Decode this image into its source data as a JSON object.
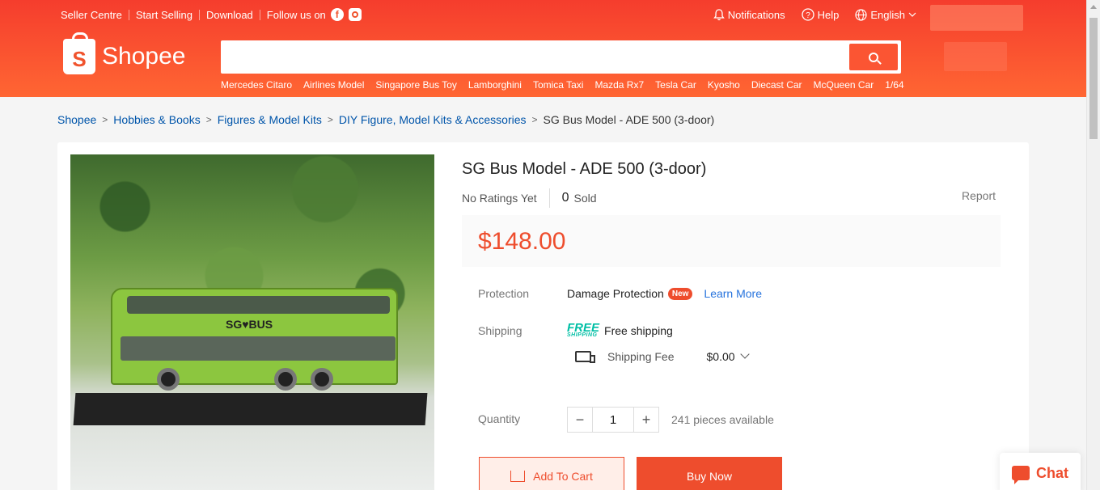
{
  "topbar": {
    "seller_centre": "Seller Centre",
    "start_selling": "Start Selling",
    "download": "Download",
    "follow_us": "Follow us on",
    "notifications": "Notifications",
    "help": "Help",
    "language": "English"
  },
  "header": {
    "logo_text": "Shopee",
    "search_placeholder": "",
    "hints": [
      "Mercedes Citaro",
      "Airlines Model",
      "Singapore Bus Toy",
      "Lamborghini",
      "Tomica Taxi",
      "Mazda Rx7",
      "Tesla Car",
      "Kyosho",
      "Diecast Car",
      "McQueen Car",
      "1/64"
    ]
  },
  "breadcrumb": {
    "items": [
      "Shopee",
      "Hobbies & Books",
      "Figures & Model Kits",
      "DIY Figure, Model Kits & Accessories"
    ],
    "current": "SG Bus Model - ADE 500 (3-door)"
  },
  "product": {
    "title": "SG Bus Model - ADE 500 (3-door)",
    "ratings": "No Ratings Yet",
    "sold_count": "0",
    "sold_label": "Sold",
    "report": "Report",
    "price": "$148.00",
    "image_logo": "SG♥BUS"
  },
  "protection": {
    "label": "Protection",
    "name": "Damage Protection",
    "badge": "New",
    "learn_more": "Learn More"
  },
  "shipping": {
    "label": "Shipping",
    "free_icon_top": "FREE",
    "free_icon_bottom": "SHIPPING",
    "free_text": "Free shipping",
    "fee_label": "Shipping Fee",
    "fee_value": "$0.00"
  },
  "quantity": {
    "label": "Quantity",
    "value": "1",
    "minus": "−",
    "plus": "+",
    "available": "241 pieces available"
  },
  "actions": {
    "add_to_cart": "Add To Cart",
    "buy_now": "Buy Now"
  },
  "chat": {
    "label": "Chat"
  },
  "colors": {
    "brand": "#ee4d2d",
    "link": "#0055aa",
    "free_shipping": "#00bfa5"
  }
}
